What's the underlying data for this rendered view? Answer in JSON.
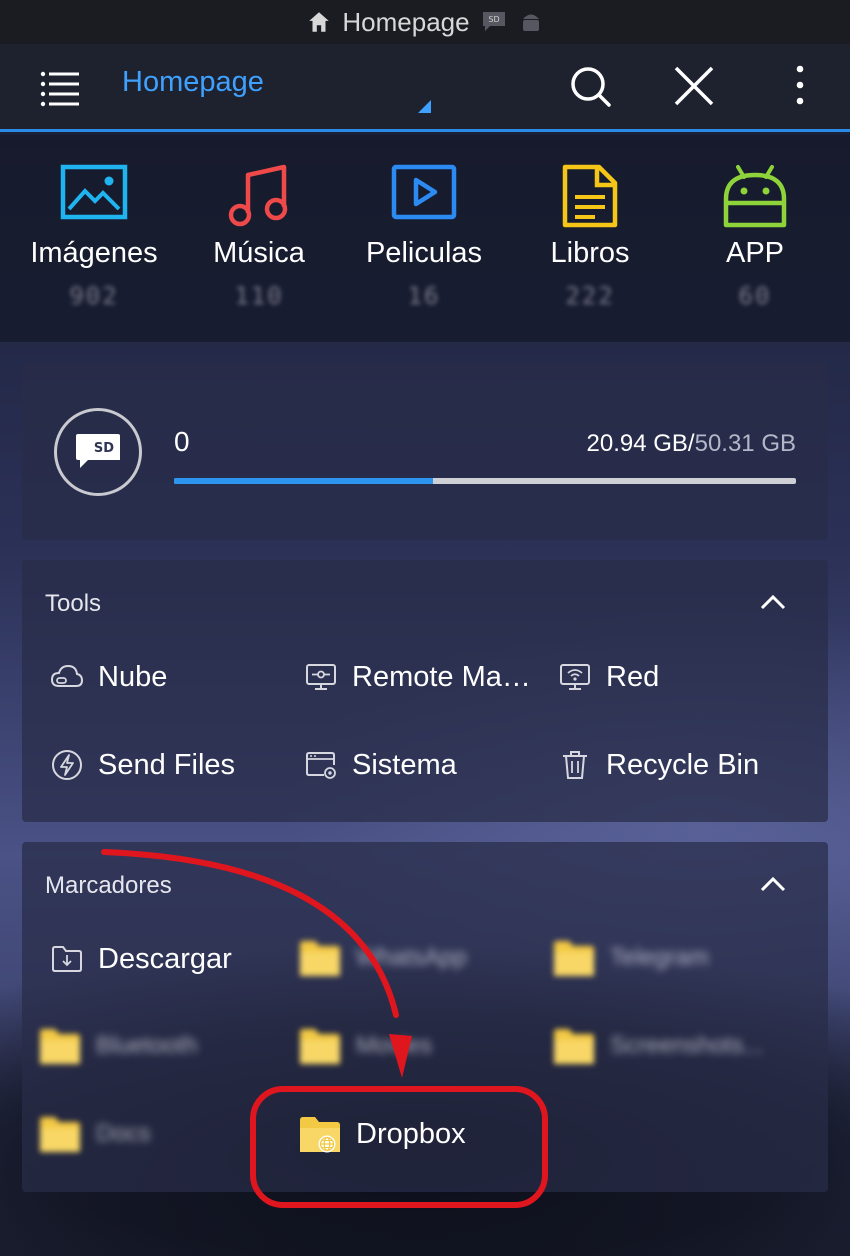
{
  "status_bar": {
    "title": "Homepage",
    "icons": [
      "home-icon",
      "sd-card-icon",
      "android-icon"
    ]
  },
  "app_bar": {
    "title": "Homepage",
    "icons": [
      "menu-icon",
      "search-icon",
      "close-icon",
      "more-vertical-icon"
    ],
    "accent_color": "#3fa1ff"
  },
  "categories": [
    {
      "label": "Imágenes",
      "count": "902",
      "icon": "image-icon",
      "color": "#1fb4f0"
    },
    {
      "label": "Música",
      "count": "110",
      "icon": "music-icon",
      "color": "#f0494a"
    },
    {
      "label": "Peliculas",
      "count": "16",
      "icon": "video-icon",
      "color": "#2b8bf2"
    },
    {
      "label": "Libros",
      "count": "222",
      "icon": "document-icon",
      "color": "#f5c518"
    },
    {
      "label": "APP",
      "count": "60",
      "icon": "android-icon",
      "color": "#8fd33a"
    }
  ],
  "storage": {
    "name": "0",
    "used": "20.94 GB",
    "separator": "/",
    "total": "50.31 GB",
    "used_fraction": 0.4162,
    "bar_color": "#2d95ee"
  },
  "tools": {
    "title": "Tools",
    "items": [
      {
        "label": "Nube",
        "icon": "cloud-icon"
      },
      {
        "label": "Remote Ma…",
        "icon": "remote-monitor-icon"
      },
      {
        "label": "Red",
        "icon": "network-icon"
      },
      {
        "label": "Send Files",
        "icon": "lightning-icon"
      },
      {
        "label": "Sistema",
        "icon": "system-settings-icon"
      },
      {
        "label": "Recycle Bin",
        "icon": "trash-icon"
      }
    ]
  },
  "bookmarks": {
    "title": "Marcadores",
    "items": [
      {
        "label": "Descargar",
        "icon": "download-folder-icon"
      },
      {
        "label": "WhatsApp",
        "icon": "folder-icon",
        "blurred": true
      },
      {
        "label": "Telegram",
        "icon": "folder-icon",
        "blurred": true
      },
      {
        "label": "Bluetooth",
        "icon": "folder-icon",
        "blurred": true
      },
      {
        "label": "Movies",
        "icon": "folder-icon",
        "blurred": true
      },
      {
        "label": "Screenshots...",
        "icon": "folder-icon",
        "blurred": true
      },
      {
        "label": "Docs",
        "icon": "folder-icon",
        "blurred": true
      },
      {
        "label": "Dropbox",
        "icon": "folder-network-icon"
      }
    ]
  },
  "annotation_color": "#e0161e"
}
